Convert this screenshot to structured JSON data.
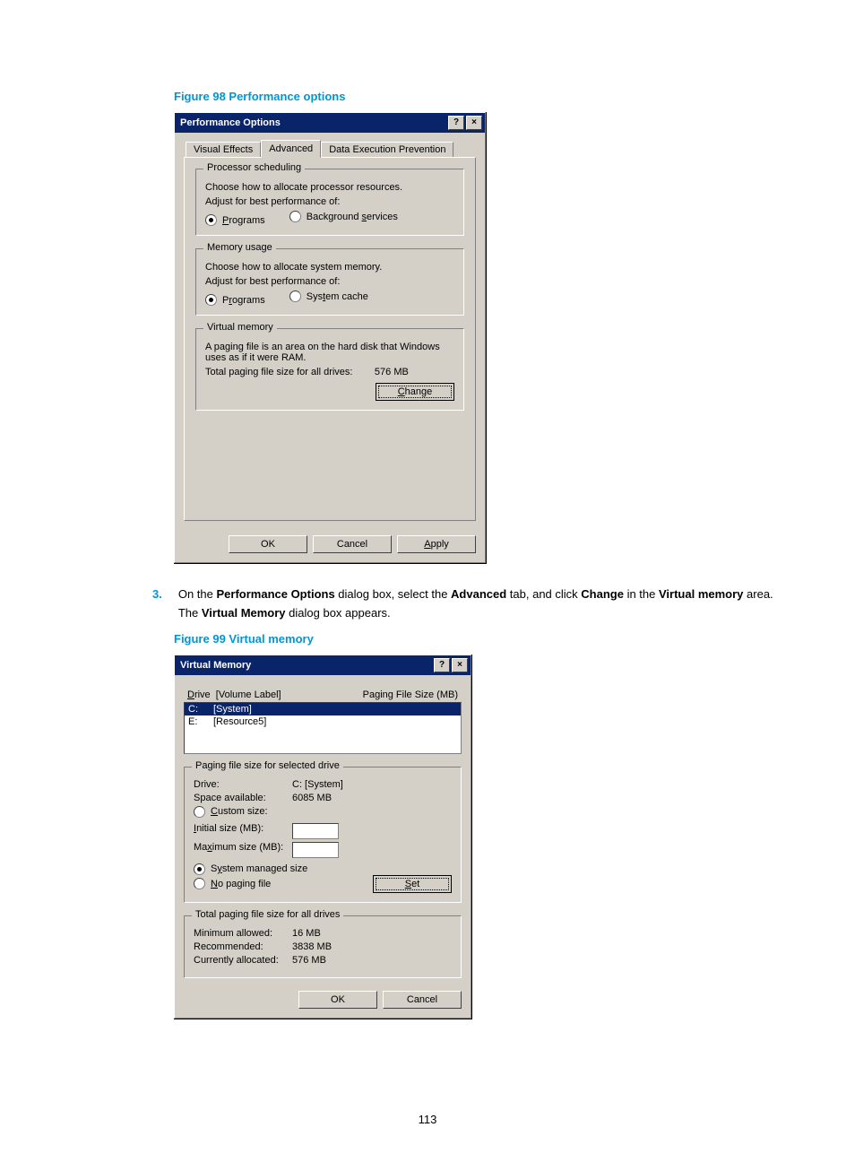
{
  "fig98_caption": "Figure 98 Performance options",
  "fig99_caption": "Figure 99 Virtual memory",
  "step_num": "3.",
  "step_text_parts": [
    "On the ",
    "Performance Options",
    " dialog box, select the ",
    "Advanced",
    " tab, and click ",
    "Change",
    " in the ",
    "Virtual memory",
    " area. The ",
    "Virtual Memory",
    " dialog box appears."
  ],
  "pagenum": "113",
  "perf": {
    "title": "Performance Options",
    "tabs": [
      "Visual Effects",
      "Advanced",
      "Data Execution Prevention"
    ],
    "active_tab": 1,
    "proc_sched": {
      "legend": "Processor scheduling",
      "desc": "Choose how to allocate processor resources.",
      "adjust": "Adjust for best performance of:",
      "opt1": "Programs",
      "opt2": "Background services"
    },
    "mem_usage": {
      "legend": "Memory usage",
      "desc": "Choose how to allocate system memory.",
      "adjust": "Adjust for best performance of:",
      "opt1": "Programs",
      "opt2": "System cache"
    },
    "vmem": {
      "legend": "Virtual memory",
      "desc": "A paging file is an area on the hard disk that Windows uses as if it were RAM.",
      "total_label": "Total paging file size for all drives:",
      "total_value": "576 MB",
      "change": "Change"
    },
    "ok": "OK",
    "cancel": "Cancel",
    "apply": "Apply"
  },
  "vm": {
    "title": "Virtual Memory",
    "drive_label": "Drive  [Volume Label]",
    "size_label": "Paging File Size (MB)",
    "drives": [
      {
        "d": "C:",
        "v": "[System]",
        "sel": true
      },
      {
        "d": "E:",
        "v": "[Resource5]",
        "sel": false
      }
    ],
    "sel": {
      "legend": "Paging file size for selected drive",
      "drive_k": "Drive:",
      "drive_v": "C: [System]",
      "space_k": "Space available:",
      "space_v": "6085 MB",
      "custom": "Custom size:",
      "init": "Initial size (MB):",
      "max": "Maximum size (MB):",
      "sysmgd": "System managed size",
      "nopage": "No paging file",
      "set": "Set"
    },
    "totals": {
      "legend": "Total paging file size for all drives",
      "min_k": "Minimum allowed:",
      "min_v": "16 MB",
      "rec_k": "Recommended:",
      "rec_v": "3838 MB",
      "cur_k": "Currently allocated:",
      "cur_v": "576 MB"
    },
    "ok": "OK",
    "cancel": "Cancel"
  }
}
